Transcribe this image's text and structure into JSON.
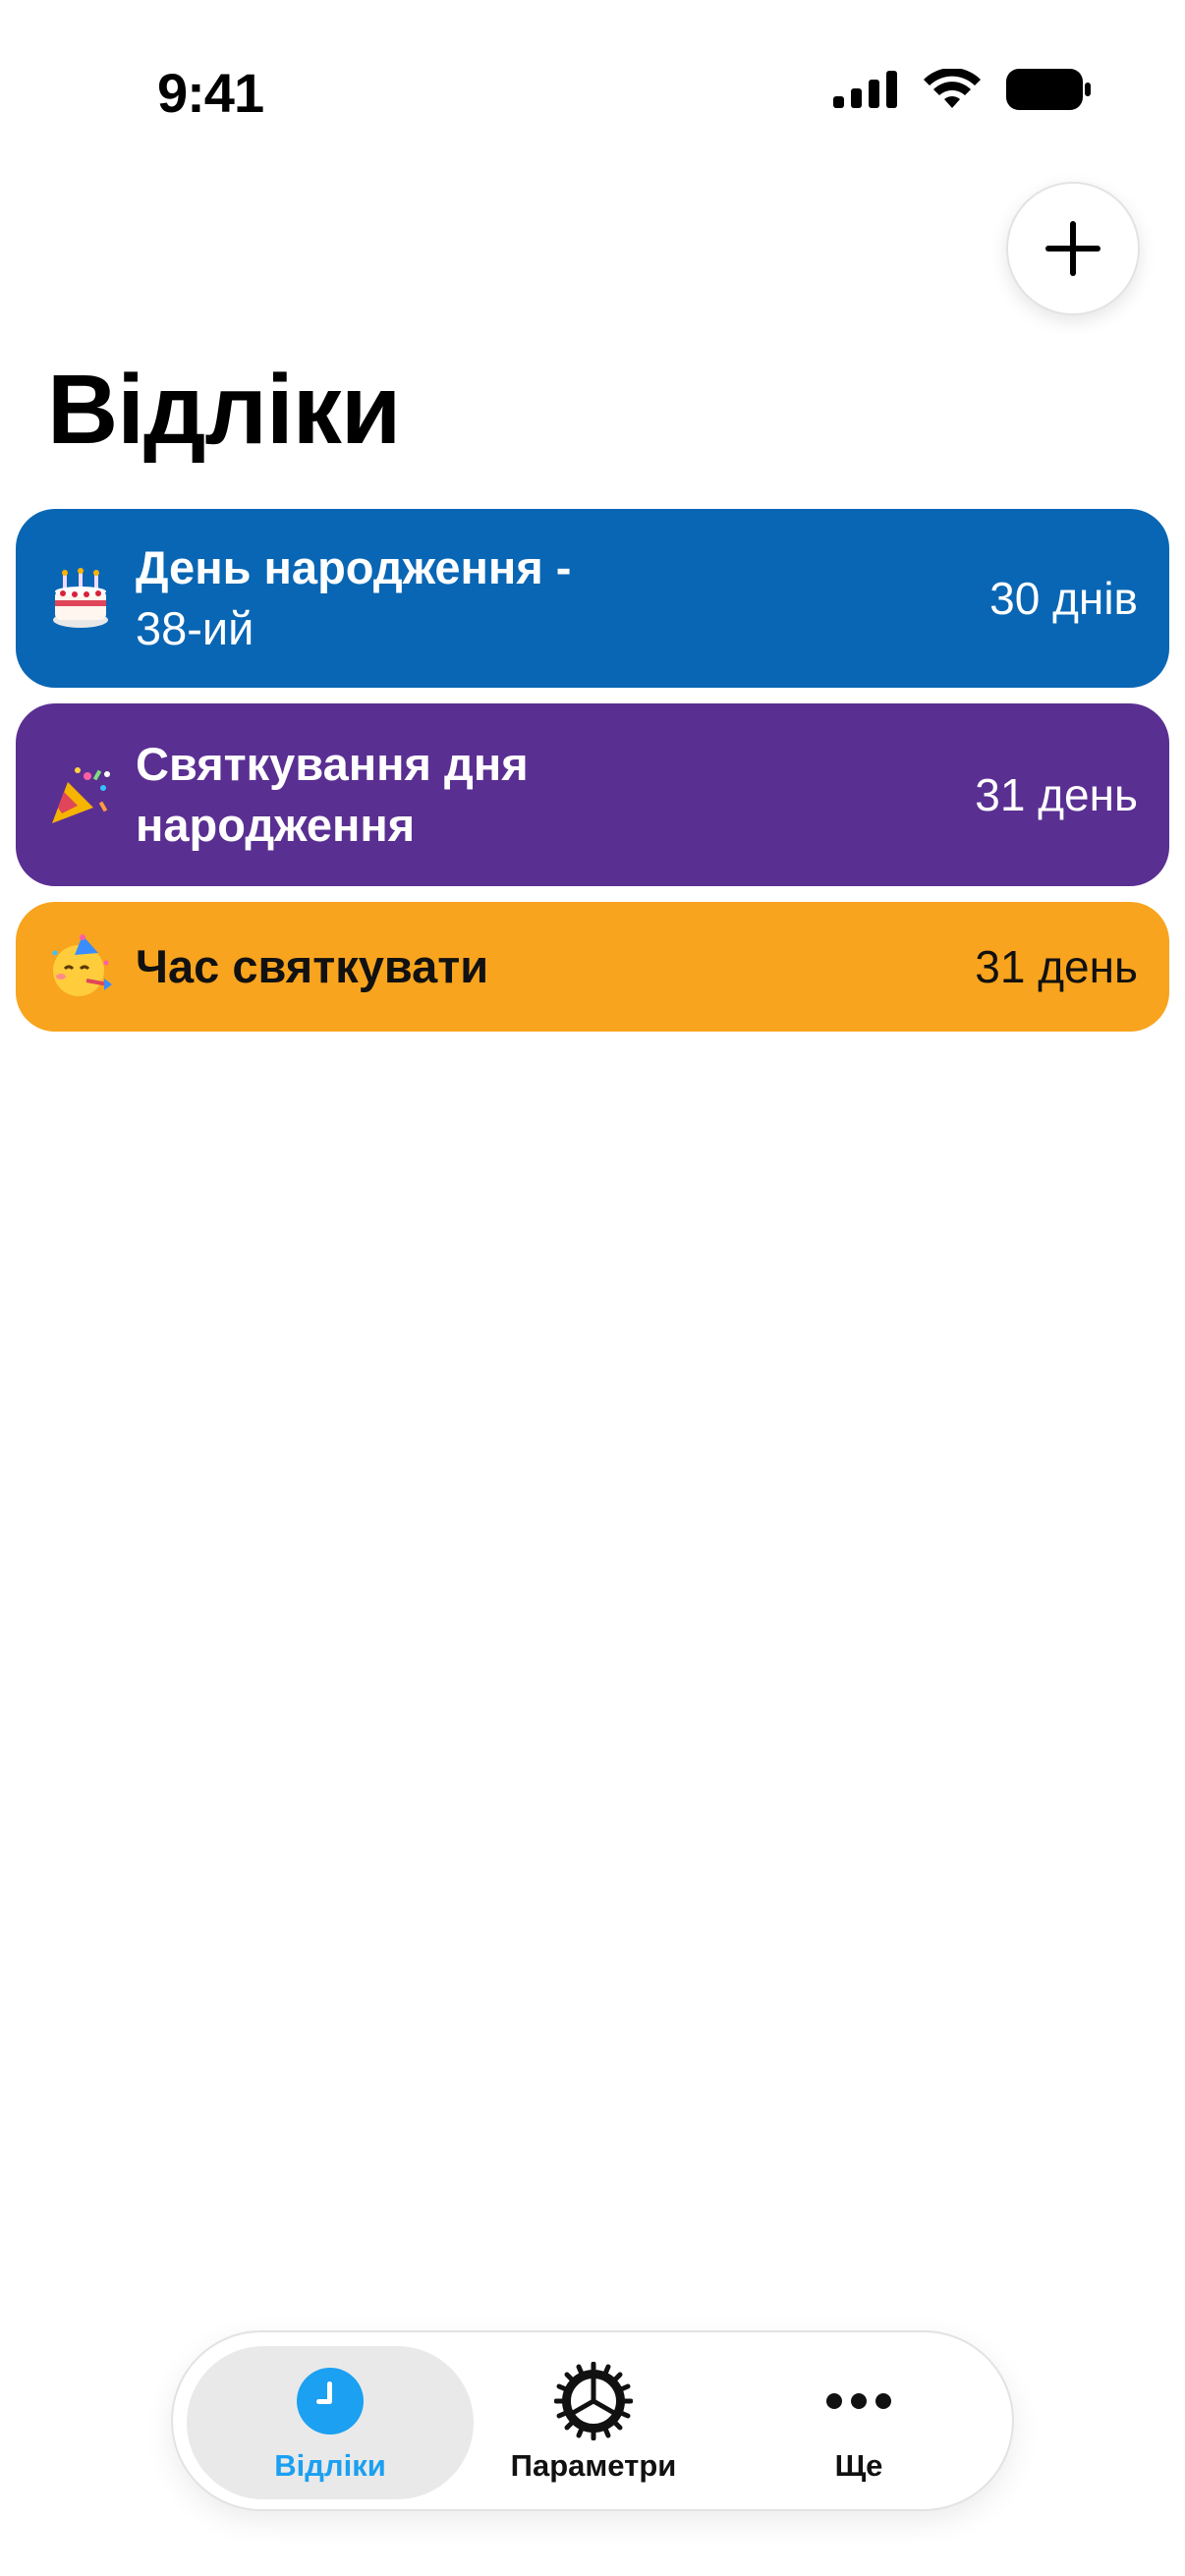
{
  "status_bar": {
    "time": "9:41"
  },
  "header": {
    "title": "Відліки",
    "add_icon": "plus-icon"
  },
  "countdowns": [
    {
      "emoji": "cake-emoji",
      "title": "День народження -",
      "subtitle": "38-ий",
      "days": "30 днів",
      "color": "#0966B4"
    },
    {
      "emoji": "party-popper-emoji",
      "title": "Святкування дня народження",
      "subtitle": "",
      "days": "31 день",
      "color": "#5A2F92"
    },
    {
      "emoji": "partying-face-emoji",
      "title": "Час святкувати",
      "subtitle": "",
      "days": "31 день",
      "color": "#F8A41E"
    }
  ],
  "tab_bar": {
    "tabs": [
      {
        "label": "Відліки",
        "icon": "clock-icon",
        "active": true,
        "color": "#1BA0F2"
      },
      {
        "label": "Параметри",
        "icon": "gear-icon",
        "active": false
      },
      {
        "label": "Ще",
        "icon": "ellipsis-icon",
        "active": false
      }
    ]
  }
}
